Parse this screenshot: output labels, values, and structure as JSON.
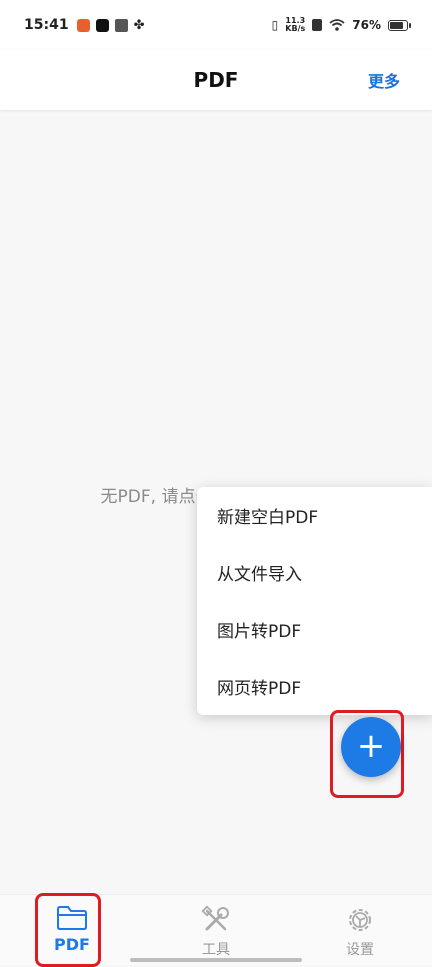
{
  "status_bar": {
    "time": "15:41",
    "net_speed_value": "11.3",
    "net_speed_unit": "KB/s",
    "battery": "76%",
    "icons": [
      "notification-icon",
      "tiktok-icon",
      "infinity-icon",
      "clover-icon",
      "vibrate-icon",
      "sim-x-icon",
      "wifi-icon",
      "battery-icon"
    ]
  },
  "header": {
    "title": "PDF",
    "more_label": "更多"
  },
  "main": {
    "empty_text": "无PDF, 请点击按钮导入或创建"
  },
  "menu": {
    "items": [
      {
        "label": "新建空白PDF"
      },
      {
        "label": "从文件导入"
      },
      {
        "label": "图片转PDF"
      },
      {
        "label": "网页转PDF"
      }
    ]
  },
  "fab": {
    "icon": "plus-icon",
    "glyph": "+"
  },
  "bottom_nav": {
    "items": [
      {
        "label": "PDF",
        "icon": "folder-icon",
        "active": true
      },
      {
        "label": "工具",
        "icon": "tools-icon",
        "active": false
      },
      {
        "label": "设置",
        "icon": "gear-icon",
        "active": false
      }
    ]
  },
  "colors": {
    "accent": "#1e7be5",
    "highlight": "#e01b24",
    "empty_text": "#8a8a8a"
  }
}
